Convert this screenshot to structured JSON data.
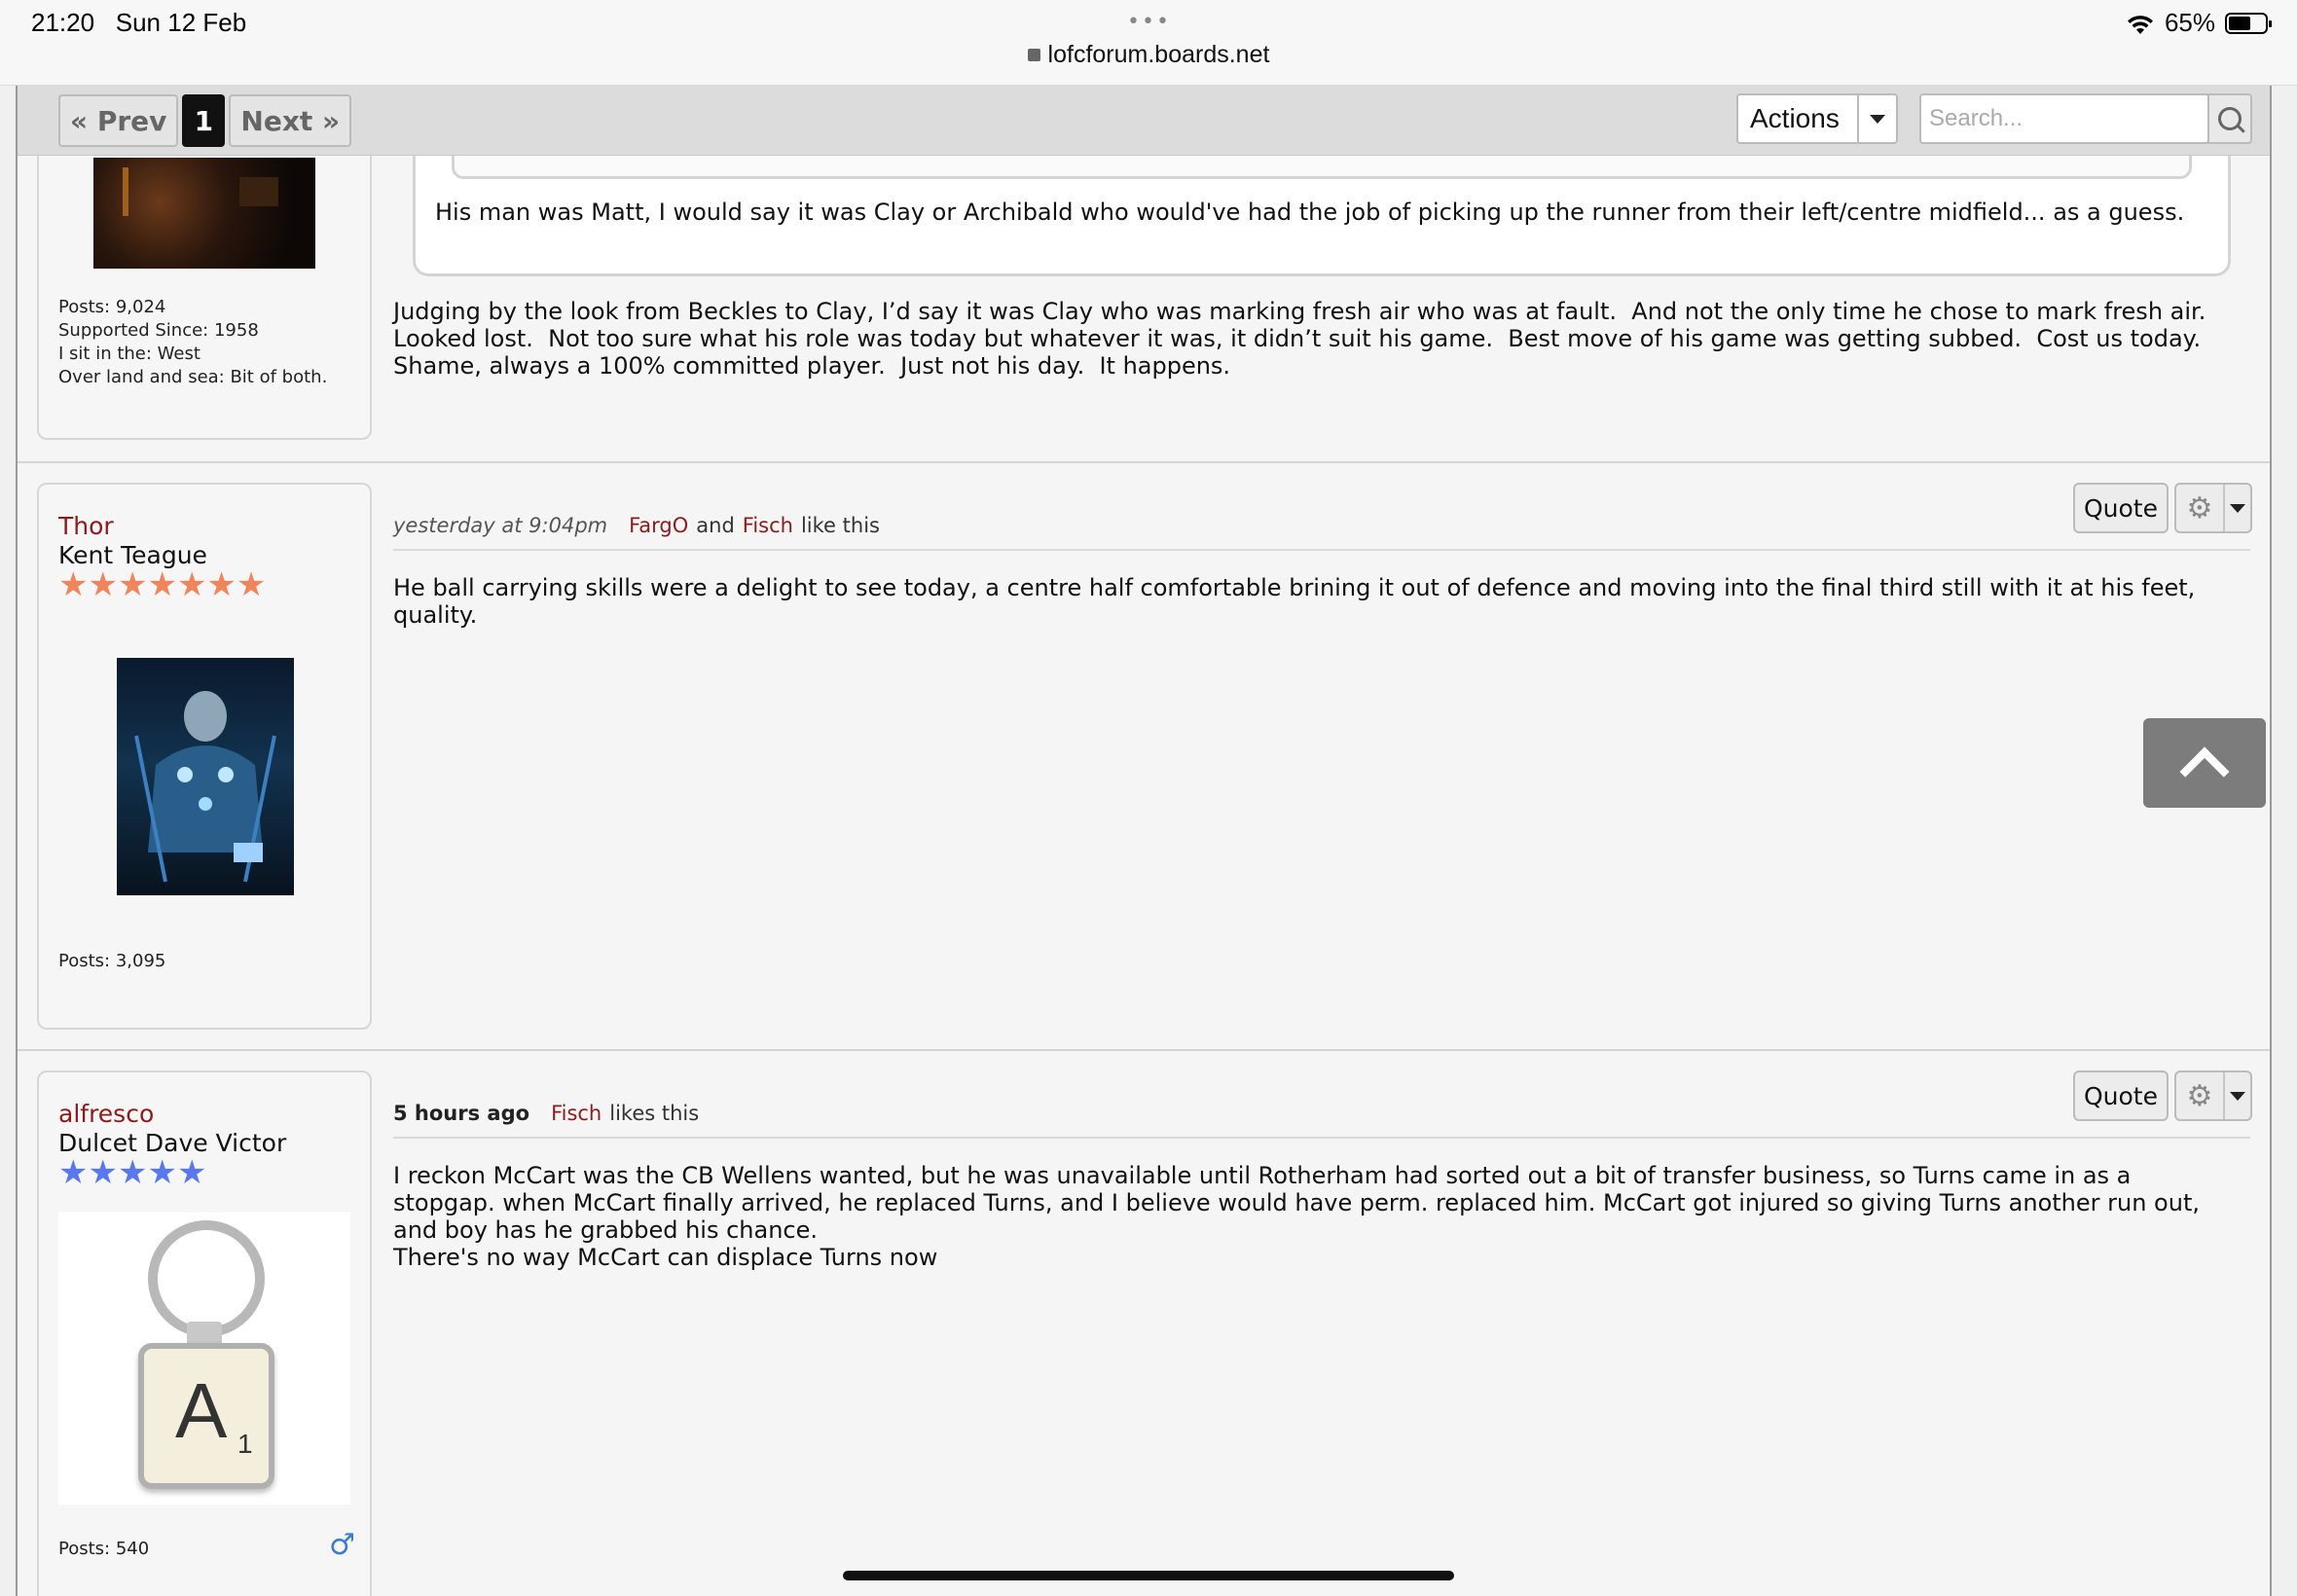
{
  "status_bar": {
    "time": "21:20",
    "date": "Sun 12 Feb",
    "url": "lofcforum.boards.net",
    "battery": "65%"
  },
  "toolbar": {
    "prev": "« Prev",
    "page": "1",
    "next": "Next »",
    "actions": "Actions",
    "search_placeholder": "Search..."
  },
  "posts": [
    {
      "stats": [
        "Posts: 9,024",
        "Supported Since: 1958",
        "I sit in the: West",
        "Over land and sea: Bit of both."
      ],
      "quote": "His man was Matt, I would say it was Clay or Archibald who would've had the job of picking up the runner from their left/centre midfield... as a guess.",
      "body": "Judging by the look from Beckles to Clay, I’d say it was Clay who was marking fresh air who was at fault.  And not the only time he chose to mark fresh air.  Looked lost.  Not too sure what his role was today but whatever it was, it didn’t suit his game.  Best move of his game was getting subbed.  Cost us today.  Shame, always a 100% committed player.  Just not his day.  It happens."
    },
    {
      "username": "Thor",
      "rank": "Kent Teague",
      "stars": 7,
      "star_color": "#f0845a",
      "stats": [
        "Posts: 3,095"
      ],
      "time": "yesterday at 9:04pm",
      "likers": [
        "FargO",
        "Fisch"
      ],
      "likes_join": "and",
      "likes_suffix": "like this",
      "body": "He ball carrying skills were a delight to see today, a centre half comfortable brining it out of defence and moving into the final third still with it at his feet, quality.",
      "quote_label": "Quote"
    },
    {
      "username": "alfresco",
      "rank": "Dulcet Dave Victor",
      "stars": 5,
      "star_color": "#5a78ee",
      "stats": [
        "Posts: 540"
      ],
      "time": "5 hours ago",
      "likers": [
        "Fisch"
      ],
      "likes_suffix": "likes this",
      "body": "I reckon McCart was the CB Wellens wanted, but he was unavailable until Rotherham had sorted out a bit of transfer business, so Turns came in as a stopgap. when McCart finally arrived, he replaced Turns, and I believe would have perm. replaced him. McCart got injured so giving Turns another run out, and boy has he grabbed his chance.\nThere's no way McCart can displace Turns now",
      "quote_label": "Quote",
      "avatar_letter": "A",
      "avatar_subscript": "1"
    }
  ]
}
